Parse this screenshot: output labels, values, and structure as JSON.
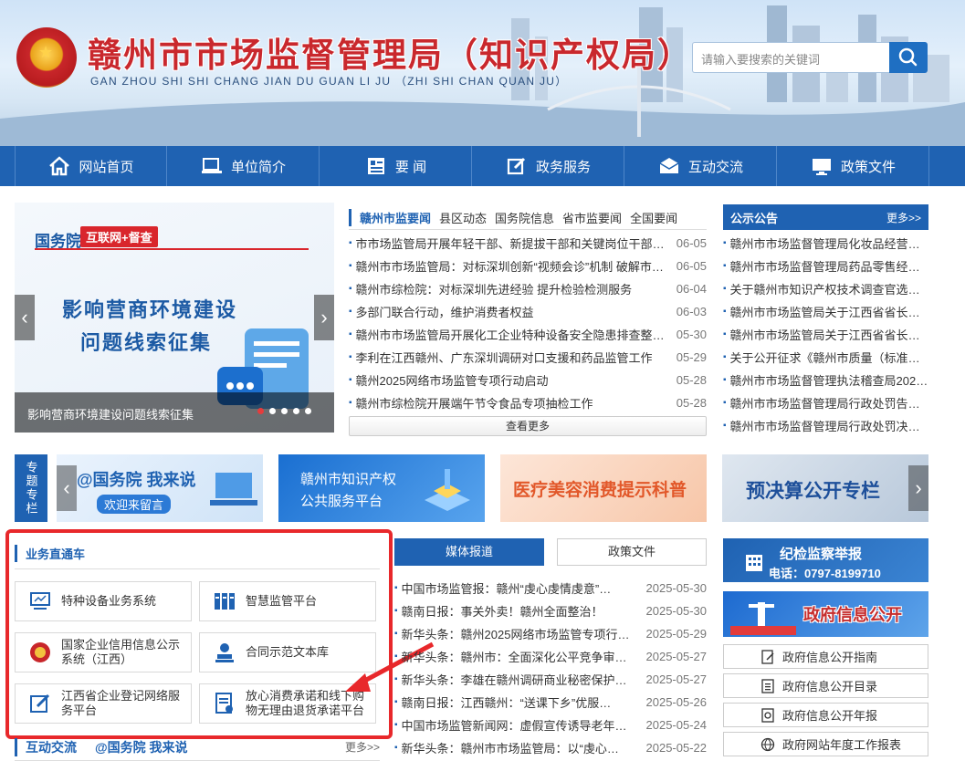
{
  "header": {
    "title": "赣州市市场监督管理局（知识产权局）",
    "pinyin": "GAN ZHOU SHI SHI CHANG JIAN DU GUAN LI JU  （ZHI SHI CHAN QUAN JU）",
    "search_placeholder": "请输入要搜索的关键词"
  },
  "nav": [
    {
      "label": "网站首页",
      "icon": "home-icon"
    },
    {
      "label": "单位简介",
      "icon": "computer-icon"
    },
    {
      "label": "要 闻",
      "icon": "news-icon"
    },
    {
      "label": "政务服务",
      "icon": "edit-icon"
    },
    {
      "label": "互动交流",
      "icon": "mail-icon"
    },
    {
      "label": "政策文件",
      "icon": "monitor-icon"
    }
  ],
  "carousel": {
    "gwy": "国务院",
    "tag": "互联网+督查",
    "heading1": "影响营商环境建设",
    "heading2": "问题线索征集",
    "caption": "影响营商环境建设问题线索征集"
  },
  "news": {
    "tabs": [
      "赣州市监要闻",
      "县区动态",
      "国务院信息",
      "省市监要闻",
      "全国要闻"
    ],
    "items": [
      {
        "title": "市市场监管局开展年轻干部、新提拔干部和关键岗位干部及…",
        "date": "06-05"
      },
      {
        "title": "赣州市市场监管局：对标深圳创新“视频会诊”机制 破解市…",
        "date": "06-05"
      },
      {
        "title": "赣州市综检院：对标深圳先进经验 提升检验检测服务",
        "date": "06-04"
      },
      {
        "title": "多部门联合行动，维护消费者权益",
        "date": "06-03"
      },
      {
        "title": "赣州市市场监管局开展化工企业特种设备安全隐患排查整治…",
        "date": "05-30"
      },
      {
        "title": "李利在江西赣州、广东深圳调研对口支援和药品监管工作",
        "date": "05-29"
      },
      {
        "title": "赣州2025网络市场监管专项行动启动",
        "date": "05-28"
      },
      {
        "title": "赣州市综检院开展端午节令食品专项抽检工作",
        "date": "05-28"
      }
    ],
    "more": "查看更多"
  },
  "notice": {
    "title": "公示公告",
    "more": "更多>>",
    "items": [
      "赣州市市场监督管理局化妆品经营单…",
      "赣州市市场监督管理局药品零售经营…",
      "关于赣州市知识产权技术调查官选聘…",
      "赣州市市场监管局关于江西省省长质…",
      "赣州市市场监管局关于江西省省长质…",
      "关于公开征求《赣州市质量（标准、…",
      "赣州市市场监督管理执法稽查局202…",
      "赣州市市场监督管理局行政处罚告知…",
      "赣州市市场监督管理局行政处罚决定…"
    ]
  },
  "special": {
    "label": "专题专栏",
    "banners": [
      {
        "line1": "@国务院 我来说",
        "line2": "欢迎来留言"
      },
      {
        "line1": "赣州市知识产权",
        "line2": "公共服务平台"
      },
      {
        "line1": "医疗美容消费提示科普",
        "line2": ""
      },
      {
        "line1": "预决算公开专栏",
        "line2": ""
      }
    ]
  },
  "business": {
    "title": "业务直通车",
    "items": [
      {
        "label": "特种设备业务系统",
        "icon": "monitor-icon"
      },
      {
        "label": "智慧监管平台",
        "icon": "server-icon"
      },
      {
        "label": "国家企业信用信息公示系统（江西）",
        "icon": "national-emblem-icon"
      },
      {
        "label": "合同示范文本库",
        "icon": "user-stamp-icon"
      },
      {
        "label": "江西省企业登记网络服务平台",
        "icon": "form-edit-icon"
      },
      {
        "label": "放心消费承诺和线下购物无理由退货承诺平台",
        "icon": "document-icon"
      }
    ]
  },
  "bottom_tabs": {
    "a": "互动交流",
    "b": "@国务院 我来说",
    "more": "更多>>"
  },
  "media": {
    "tabs": [
      "媒体报道",
      "政策文件"
    ],
    "items": [
      {
        "title": "中国市场监管报：赣州“虔心虔情虔意”…",
        "date": "2025-05-30"
      },
      {
        "title": "赣南日报：事关外卖！赣州全面整治！",
        "date": "2025-05-30"
      },
      {
        "title": "新华头条：赣州2025网络市场监管专项行…",
        "date": "2025-05-29"
      },
      {
        "title": "新华头条：赣州市：全面深化公平竞争审…",
        "date": "2025-05-27"
      },
      {
        "title": "新华头条：李雄在赣州调研商业秘密保护…",
        "date": "2025-05-27"
      },
      {
        "title": "赣南日报：江西赣州：“送课下乡”优服…",
        "date": "2025-05-26"
      },
      {
        "title": "中国市场监管新闻网：虚假宣传诱导老年…",
        "date": "2025-05-24"
      },
      {
        "title": "新华头条：赣州市市场监管局：以“虔心…",
        "date": "2025-05-22"
      }
    ]
  },
  "right": {
    "jjjc_title": "纪检监察举报",
    "jjjc_phone": "电话：0797-8199710",
    "gov_title": "政府信息公开",
    "links": [
      "政府信息公开指南",
      "政府信息公开目录",
      "政府信息公开年报",
      "政府网站年度工作报表"
    ]
  },
  "colors": {
    "brand_blue": "#1f62b2",
    "title_red": "#c9282d",
    "highlight_red": "#e8282b"
  }
}
